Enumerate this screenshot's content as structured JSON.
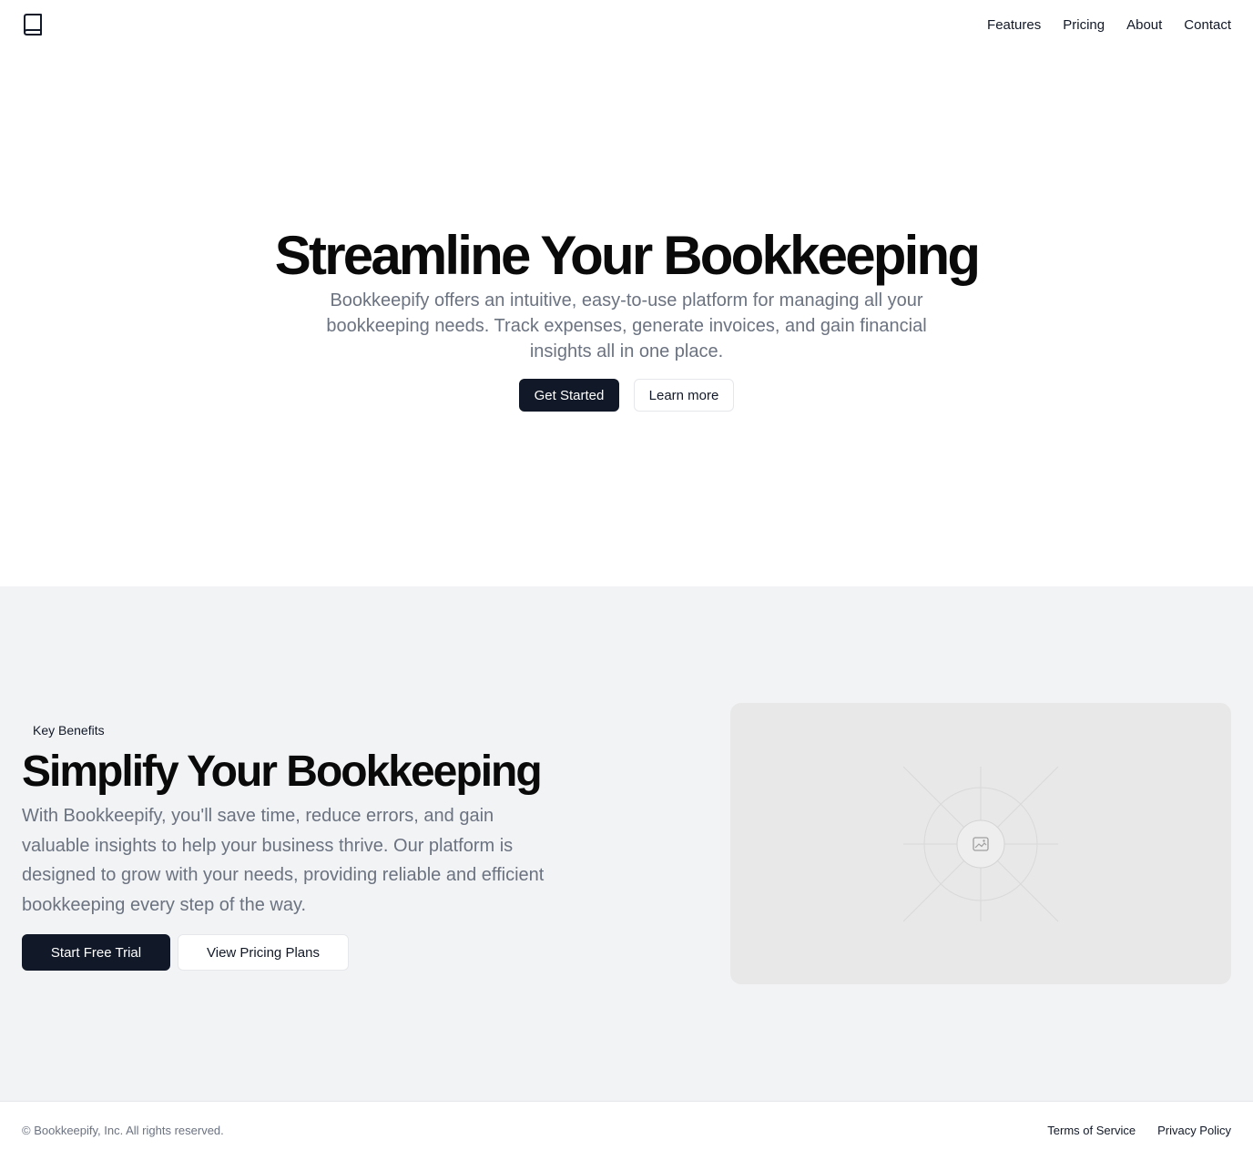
{
  "header": {
    "logo_icon": "book-icon",
    "nav": [
      {
        "label": "Features"
      },
      {
        "label": "Pricing"
      },
      {
        "label": "About"
      },
      {
        "label": "Contact"
      }
    ]
  },
  "hero": {
    "title": "Streamline Your Bookkeeping",
    "subtitle": "Bookkeepify offers an intuitive, easy-to-use platform for managing all your bookkeeping needs. Track expenses, generate invoices, and gain financial insights all in one place.",
    "primary_button": "Get Started",
    "secondary_button": "Learn more"
  },
  "benefits": {
    "badge": "Key Benefits",
    "title": "Simplify Your Bookkeeping",
    "text": "With Bookkeepify, you'll save time, reduce errors, and gain valuable insights to help your business thrive. Our platform is designed to grow with your needs, providing reliable and efficient bookkeeping every step of the way.",
    "primary_button": "Start Free Trial",
    "secondary_button": "View Pricing Plans",
    "image_icon": "image-placeholder-icon"
  },
  "footer": {
    "copyright": "© Bookkeepify, Inc. All rights reserved.",
    "links": [
      {
        "label": "Terms of Service"
      },
      {
        "label": "Privacy Policy"
      }
    ]
  },
  "colors": {
    "primary": "#111827",
    "muted_text": "#6b7280",
    "section_bg": "#f2f3f5",
    "placeholder_bg": "#e8e8e8"
  }
}
